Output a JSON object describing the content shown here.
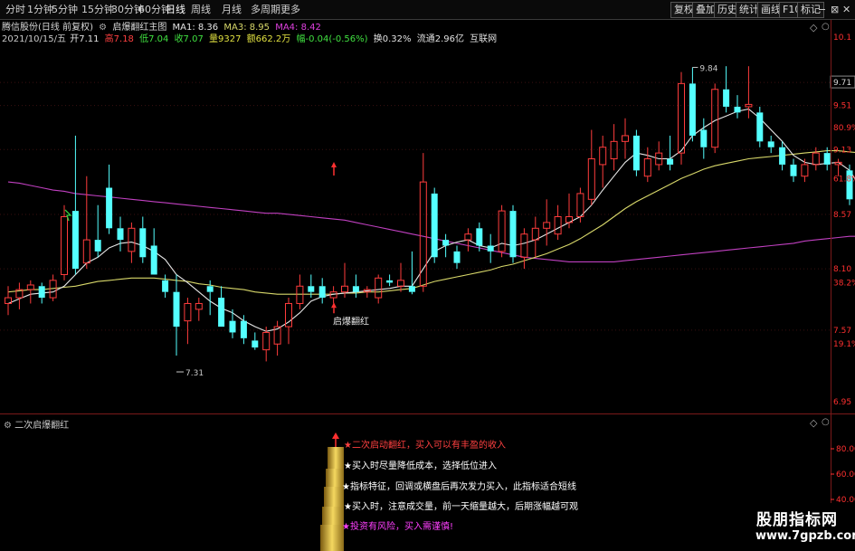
{
  "toolbar": {
    "tabs": [
      "分时",
      "1分钟",
      "5分钟",
      "15分钟",
      "30分钟",
      "60分钟",
      "日线",
      "周线",
      "月线",
      "多周期",
      "更多"
    ],
    "active_tab": "日线",
    "right_buttons": [
      "复权",
      "叠加",
      "历史",
      "统计",
      "画线",
      "F10",
      "标记"
    ],
    "window_controls": [
      "−",
      "⊠",
      "✕"
    ]
  },
  "info": {
    "stock": "腾信股份(日线 前复权)",
    "indicator": "启爆翻红主图",
    "ma1": "MA1: 8.36",
    "ma3": "MA3: 8.95",
    "ma4": "MA4: 8.42",
    "date": "2021/10/15/五",
    "open": "开7.11",
    "high": "高7.18",
    "low": "低7.04",
    "close": "收7.07",
    "volume": "量9327",
    "amount": "额662.2万",
    "change": "幅-0.04(-0.56%)",
    "turnover": "换0.32%",
    "float": "流通2.96亿",
    "sector": "互联网"
  },
  "colors": {
    "up": "#ff3c3c",
    "down": "#54ffff",
    "ma_white": "#e6e6e6",
    "ma_yellow": "#d8d86a",
    "ma_purple": "#c040c0",
    "axis_red": "#ff3030",
    "magenta": "#ff40ff",
    "gold": "#e8c030"
  },
  "annotations": {
    "high_label": "9.84",
    "low_label": "7.31",
    "signal_label": "启爆翻红"
  },
  "right_axis": [
    {
      "text": "10.1",
      "kind": "price"
    },
    {
      "text": "9.71",
      "kind": "price"
    },
    {
      "text": "9.51",
      "kind": "price"
    },
    {
      "text": "80.9%",
      "kind": "pct"
    },
    {
      "text": "9.13",
      "kind": "price"
    },
    {
      "text": "61.8%",
      "kind": "pct"
    },
    {
      "text": "8.57",
      "kind": "price"
    },
    {
      "text": "8.10",
      "kind": "price"
    },
    {
      "text": "38.2%",
      "kind": "pct"
    },
    {
      "text": "7.57",
      "kind": "price"
    },
    {
      "text": "19.1%",
      "kind": "pct"
    },
    {
      "text": "6.95",
      "kind": "price"
    }
  ],
  "sub_panel": {
    "title": "二次启爆翻红",
    "axis": [
      "80.00",
      "60.00",
      "40.00",
      "20.00"
    ],
    "notes": [
      {
        "text": "★二次启动翻红，买入可以有丰盈的收入",
        "color": "#ff4040"
      },
      {
        "text": "★买入时尽量降低成本，选择低位进入",
        "color": "#ffffff"
      },
      {
        "text": "★指标特征，回调或横盘后再次发力买入，此指标适合短线",
        "color": "#ffffff"
      },
      {
        "text": "★买入时，注意成交量，前一天缩量越大，后期涨幅越可观",
        "color": "#ffffff"
      },
      {
        "text": "★投资有风险，买入需谨慎!",
        "color": "#ff40ff"
      }
    ]
  },
  "watermark": {
    "line1": "股朋指标网",
    "line2": "www.7gpzb.com"
  },
  "chart_data": {
    "type": "candlestick",
    "ylim": [
      6.85,
      10.25
    ],
    "candles": [
      {
        "o": 7.8,
        "h": 7.95,
        "l": 7.7,
        "c": 7.85
      },
      {
        "o": 7.85,
        "h": 7.98,
        "l": 7.75,
        "c": 7.92
      },
      {
        "o": 7.92,
        "h": 8.0,
        "l": 7.8,
        "c": 7.96
      },
      {
        "o": 7.95,
        "h": 7.98,
        "l": 7.8,
        "c": 7.85
      },
      {
        "o": 7.85,
        "h": 8.05,
        "l": 7.82,
        "c": 8.0
      },
      {
        "o": 8.05,
        "h": 8.65,
        "l": 8.0,
        "c": 8.55
      },
      {
        "o": 8.6,
        "h": 9.25,
        "l": 8.05,
        "c": 8.1
      },
      {
        "o": 8.15,
        "h": 8.9,
        "l": 8.1,
        "c": 8.35
      },
      {
        "o": 8.35,
        "h": 8.65,
        "l": 8.2,
        "c": 8.25
      },
      {
        "o": 8.8,
        "h": 9.0,
        "l": 8.4,
        "c": 8.45
      },
      {
        "o": 8.45,
        "h": 8.55,
        "l": 8.25,
        "c": 8.35
      },
      {
        "o": 8.25,
        "h": 8.5,
        "l": 8.15,
        "c": 8.45
      },
      {
        "o": 8.45,
        "h": 8.55,
        "l": 8.15,
        "c": 8.2
      },
      {
        "o": 8.3,
        "h": 8.45,
        "l": 8.2,
        "c": 8.05
      },
      {
        "o": 8.0,
        "h": 8.05,
        "l": 7.85,
        "c": 7.9
      },
      {
        "o": 7.9,
        "h": 8.05,
        "l": 7.35,
        "c": 7.6
      },
      {
        "o": 7.65,
        "h": 7.85,
        "l": 7.45,
        "c": 7.8
      },
      {
        "o": 7.75,
        "h": 7.85,
        "l": 7.65,
        "c": 7.8
      },
      {
        "o": 7.95,
        "h": 8.0,
        "l": 7.7,
        "c": 7.9
      },
      {
        "o": 7.85,
        "h": 7.95,
        "l": 7.6,
        "c": 7.6
      },
      {
        "o": 7.65,
        "h": 7.75,
        "l": 7.5,
        "c": 7.55
      },
      {
        "o": 7.65,
        "h": 7.7,
        "l": 7.45,
        "c": 7.5
      },
      {
        "o": 7.48,
        "h": 7.55,
        "l": 7.4,
        "c": 7.42
      },
      {
        "o": 7.4,
        "h": 7.6,
        "l": 7.3,
        "c": 7.55
      },
      {
        "o": 7.45,
        "h": 7.65,
        "l": 7.35,
        "c": 7.6
      },
      {
        "o": 7.6,
        "h": 7.85,
        "l": 7.45,
        "c": 7.8
      },
      {
        "o": 7.8,
        "h": 8.05,
        "l": 7.75,
        "c": 7.95
      },
      {
        "o": 7.95,
        "h": 8.05,
        "l": 7.85,
        "c": 7.9
      },
      {
        "o": 7.95,
        "h": 8.02,
        "l": 7.8,
        "c": 7.85
      },
      {
        "o": 7.85,
        "h": 7.95,
        "l": 7.8,
        "c": 7.9
      },
      {
        "o": 7.9,
        "h": 8.15,
        "l": 7.85,
        "c": 7.95
      },
      {
        "o": 7.95,
        "h": 8.05,
        "l": 7.85,
        "c": 7.9
      },
      {
        "o": 7.9,
        "h": 7.95,
        "l": 7.85,
        "c": 7.92
      },
      {
        "o": 7.85,
        "h": 8.05,
        "l": 7.8,
        "c": 8.02
      },
      {
        "o": 8.0,
        "h": 8.05,
        "l": 7.95,
        "c": 7.98
      },
      {
        "o": 7.95,
        "h": 8.15,
        "l": 7.9,
        "c": 8.0
      },
      {
        "o": 7.95,
        "h": 8.25,
        "l": 7.88,
        "c": 7.9
      },
      {
        "o": 7.95,
        "h": 9.1,
        "l": 7.9,
        "c": 8.85
      },
      {
        "o": 8.75,
        "h": 8.8,
        "l": 8.15,
        "c": 8.2
      },
      {
        "o": 8.35,
        "h": 8.4,
        "l": 8.2,
        "c": 8.3
      },
      {
        "o": 8.25,
        "h": 8.3,
        "l": 8.1,
        "c": 8.15
      },
      {
        "o": 8.35,
        "h": 8.45,
        "l": 8.25,
        "c": 8.4
      },
      {
        "o": 8.45,
        "h": 8.5,
        "l": 8.25,
        "c": 8.3
      },
      {
        "o": 8.3,
        "h": 8.4,
        "l": 8.15,
        "c": 8.25
      },
      {
        "o": 8.25,
        "h": 8.65,
        "l": 8.2,
        "c": 8.6
      },
      {
        "o": 8.6,
        "h": 8.65,
        "l": 8.15,
        "c": 8.2
      },
      {
        "o": 8.2,
        "h": 8.45,
        "l": 8.1,
        "c": 8.4
      },
      {
        "o": 8.35,
        "h": 8.55,
        "l": 8.2,
        "c": 8.45
      },
      {
        "o": 8.45,
        "h": 8.7,
        "l": 8.3,
        "c": 8.5
      },
      {
        "o": 8.4,
        "h": 8.65,
        "l": 8.35,
        "c": 8.55
      },
      {
        "o": 8.5,
        "h": 8.75,
        "l": 8.45,
        "c": 8.55
      },
      {
        "o": 8.55,
        "h": 8.8,
        "l": 8.5,
        "c": 8.75
      },
      {
        "o": 8.7,
        "h": 9.3,
        "l": 8.65,
        "c": 9.05
      },
      {
        "o": 9.0,
        "h": 9.25,
        "l": 8.8,
        "c": 9.15
      },
      {
        "o": 9.05,
        "h": 9.35,
        "l": 8.95,
        "c": 9.2
      },
      {
        "o": 9.2,
        "h": 9.4,
        "l": 9.05,
        "c": 9.25
      },
      {
        "o": 9.25,
        "h": 9.3,
        "l": 8.9,
        "c": 8.95
      },
      {
        "o": 8.9,
        "h": 9.15,
        "l": 8.85,
        "c": 9.05
      },
      {
        "o": 9.0,
        "h": 9.2,
        "l": 8.95,
        "c": 9.1
      },
      {
        "o": 9.05,
        "h": 9.25,
        "l": 8.95,
        "c": 9.0
      },
      {
        "o": 9.1,
        "h": 9.8,
        "l": 9.0,
        "c": 9.7
      },
      {
        "o": 9.7,
        "h": 9.84,
        "l": 9.2,
        "c": 9.25
      },
      {
        "o": 9.3,
        "h": 9.4,
        "l": 9.05,
        "c": 9.15
      },
      {
        "o": 9.15,
        "h": 9.7,
        "l": 9.1,
        "c": 9.65
      },
      {
        "o": 9.65,
        "h": 9.85,
        "l": 9.45,
        "c": 9.5
      },
      {
        "o": 9.5,
        "h": 9.6,
        "l": 9.4,
        "c": 9.45
      },
      {
        "o": 9.5,
        "h": 9.85,
        "l": 9.4,
        "c": 9.52
      },
      {
        "o": 9.45,
        "h": 9.5,
        "l": 9.15,
        "c": 9.2
      },
      {
        "o": 9.2,
        "h": 9.25,
        "l": 9.1,
        "c": 9.15
      },
      {
        "o": 9.15,
        "h": 9.2,
        "l": 8.95,
        "c": 9.0
      },
      {
        "o": 9.0,
        "h": 9.05,
        "l": 8.85,
        "c": 8.9
      },
      {
        "o": 8.9,
        "h": 9.05,
        "l": 8.85,
        "c": 9.0
      },
      {
        "o": 9.0,
        "h": 9.15,
        "l": 8.95,
        "c": 9.1
      },
      {
        "o": 9.1,
        "h": 9.15,
        "l": 8.95,
        "c": 9.0
      },
      {
        "o": 9.0,
        "h": 9.05,
        "l": 8.9,
        "c": 9.02
      },
      {
        "o": 8.95,
        "h": 9.0,
        "l": 8.65,
        "c": 8.7
      },
      {
        "o": 8.7,
        "h": 8.75,
        "l": 8.4,
        "c": 8.45
      },
      {
        "o": 8.45,
        "h": 8.5,
        "l": 8.25,
        "c": 8.4
      },
      {
        "o": 8.4,
        "h": 8.45,
        "l": 8.1,
        "c": 8.3
      },
      {
        "o": 8.3,
        "h": 8.4,
        "l": 8.2,
        "c": 8.35
      },
      {
        "o": 8.35,
        "h": 8.55,
        "l": 8.25,
        "c": 8.45
      },
      {
        "o": 8.45,
        "h": 8.55,
        "l": 8.2,
        "c": 8.25
      },
      {
        "o": 8.2,
        "h": 8.25,
        "l": 8.1,
        "c": 8.15
      }
    ],
    "ma_white": [
      7.8,
      7.84,
      7.88,
      7.89,
      7.9,
      7.95,
      8.05,
      8.15,
      8.2,
      8.28,
      8.32,
      8.33,
      8.3,
      8.25,
      8.18,
      8.05,
      7.98,
      7.9,
      7.82,
      7.76,
      7.72,
      7.65,
      7.6,
      7.56,
      7.58,
      7.64,
      7.72,
      7.82,
      7.86,
      7.88,
      7.89,
      7.9,
      7.91,
      7.92,
      7.93,
      7.95,
      7.95,
      8.1,
      8.25,
      8.3,
      8.33,
      8.35,
      8.3,
      8.28,
      8.32,
      8.3,
      8.32,
      8.35,
      8.4,
      8.45,
      8.5,
      8.55,
      8.65,
      8.78,
      8.9,
      9.02,
      9.1,
      9.08,
      9.05,
      9.05,
      9.12,
      9.25,
      9.32,
      9.38,
      9.42,
      9.46,
      9.48,
      9.4,
      9.3,
      9.2,
      9.08,
      9.02,
      9.0,
      9.01,
      9.02,
      8.95,
      8.8,
      8.66,
      8.52,
      8.42,
      8.38,
      8.35,
      8.3
    ],
    "ma_yellow": [
      7.9,
      7.91,
      7.92,
      7.92,
      7.93,
      7.94,
      7.95,
      7.97,
      7.99,
      8.0,
      8.01,
      8.02,
      8.02,
      8.02,
      8.01,
      8.0,
      7.99,
      7.97,
      7.96,
      7.94,
      7.93,
      7.92,
      7.9,
      7.89,
      7.88,
      7.88,
      7.88,
      7.88,
      7.88,
      7.88,
      7.89,
      7.89,
      7.9,
      7.9,
      7.91,
      7.92,
      7.93,
      7.96,
      7.99,
      8.01,
      8.03,
      8.05,
      8.07,
      8.09,
      8.12,
      8.14,
      8.17,
      8.2,
      8.23,
      8.27,
      8.31,
      8.36,
      8.42,
      8.48,
      8.55,
      8.62,
      8.68,
      8.73,
      8.78,
      8.83,
      8.88,
      8.92,
      8.96,
      8.99,
      9.01,
      9.03,
      9.05,
      9.06,
      9.07,
      9.08,
      9.09,
      9.1,
      9.11,
      9.12,
      9.12,
      9.11,
      9.1,
      9.08,
      9.06,
      9.03,
      9.0,
      8.97,
      8.93
    ],
    "ma_purple": [
      8.85,
      8.84,
      8.82,
      8.8,
      8.78,
      8.77,
      8.75,
      8.74,
      8.73,
      8.72,
      8.71,
      8.7,
      8.69,
      8.68,
      8.67,
      8.66,
      8.65,
      8.64,
      8.63,
      8.62,
      8.61,
      8.6,
      8.59,
      8.58,
      8.58,
      8.57,
      8.56,
      8.55,
      8.54,
      8.53,
      8.52,
      8.5,
      8.48,
      8.46,
      8.44,
      8.42,
      8.4,
      8.38,
      8.36,
      8.34,
      8.32,
      8.3,
      8.28,
      8.26,
      8.24,
      8.22,
      8.2,
      8.19,
      8.18,
      8.17,
      8.16,
      8.16,
      8.16,
      8.16,
      8.16,
      8.17,
      8.18,
      8.19,
      8.2,
      8.21,
      8.22,
      8.23,
      8.24,
      8.25,
      8.26,
      8.27,
      8.28,
      8.29,
      8.3,
      8.31,
      8.32,
      8.34,
      8.35,
      8.36,
      8.37,
      8.38,
      8.38,
      8.39,
      8.39,
      8.39,
      8.39,
      8.38,
      8.37
    ]
  }
}
